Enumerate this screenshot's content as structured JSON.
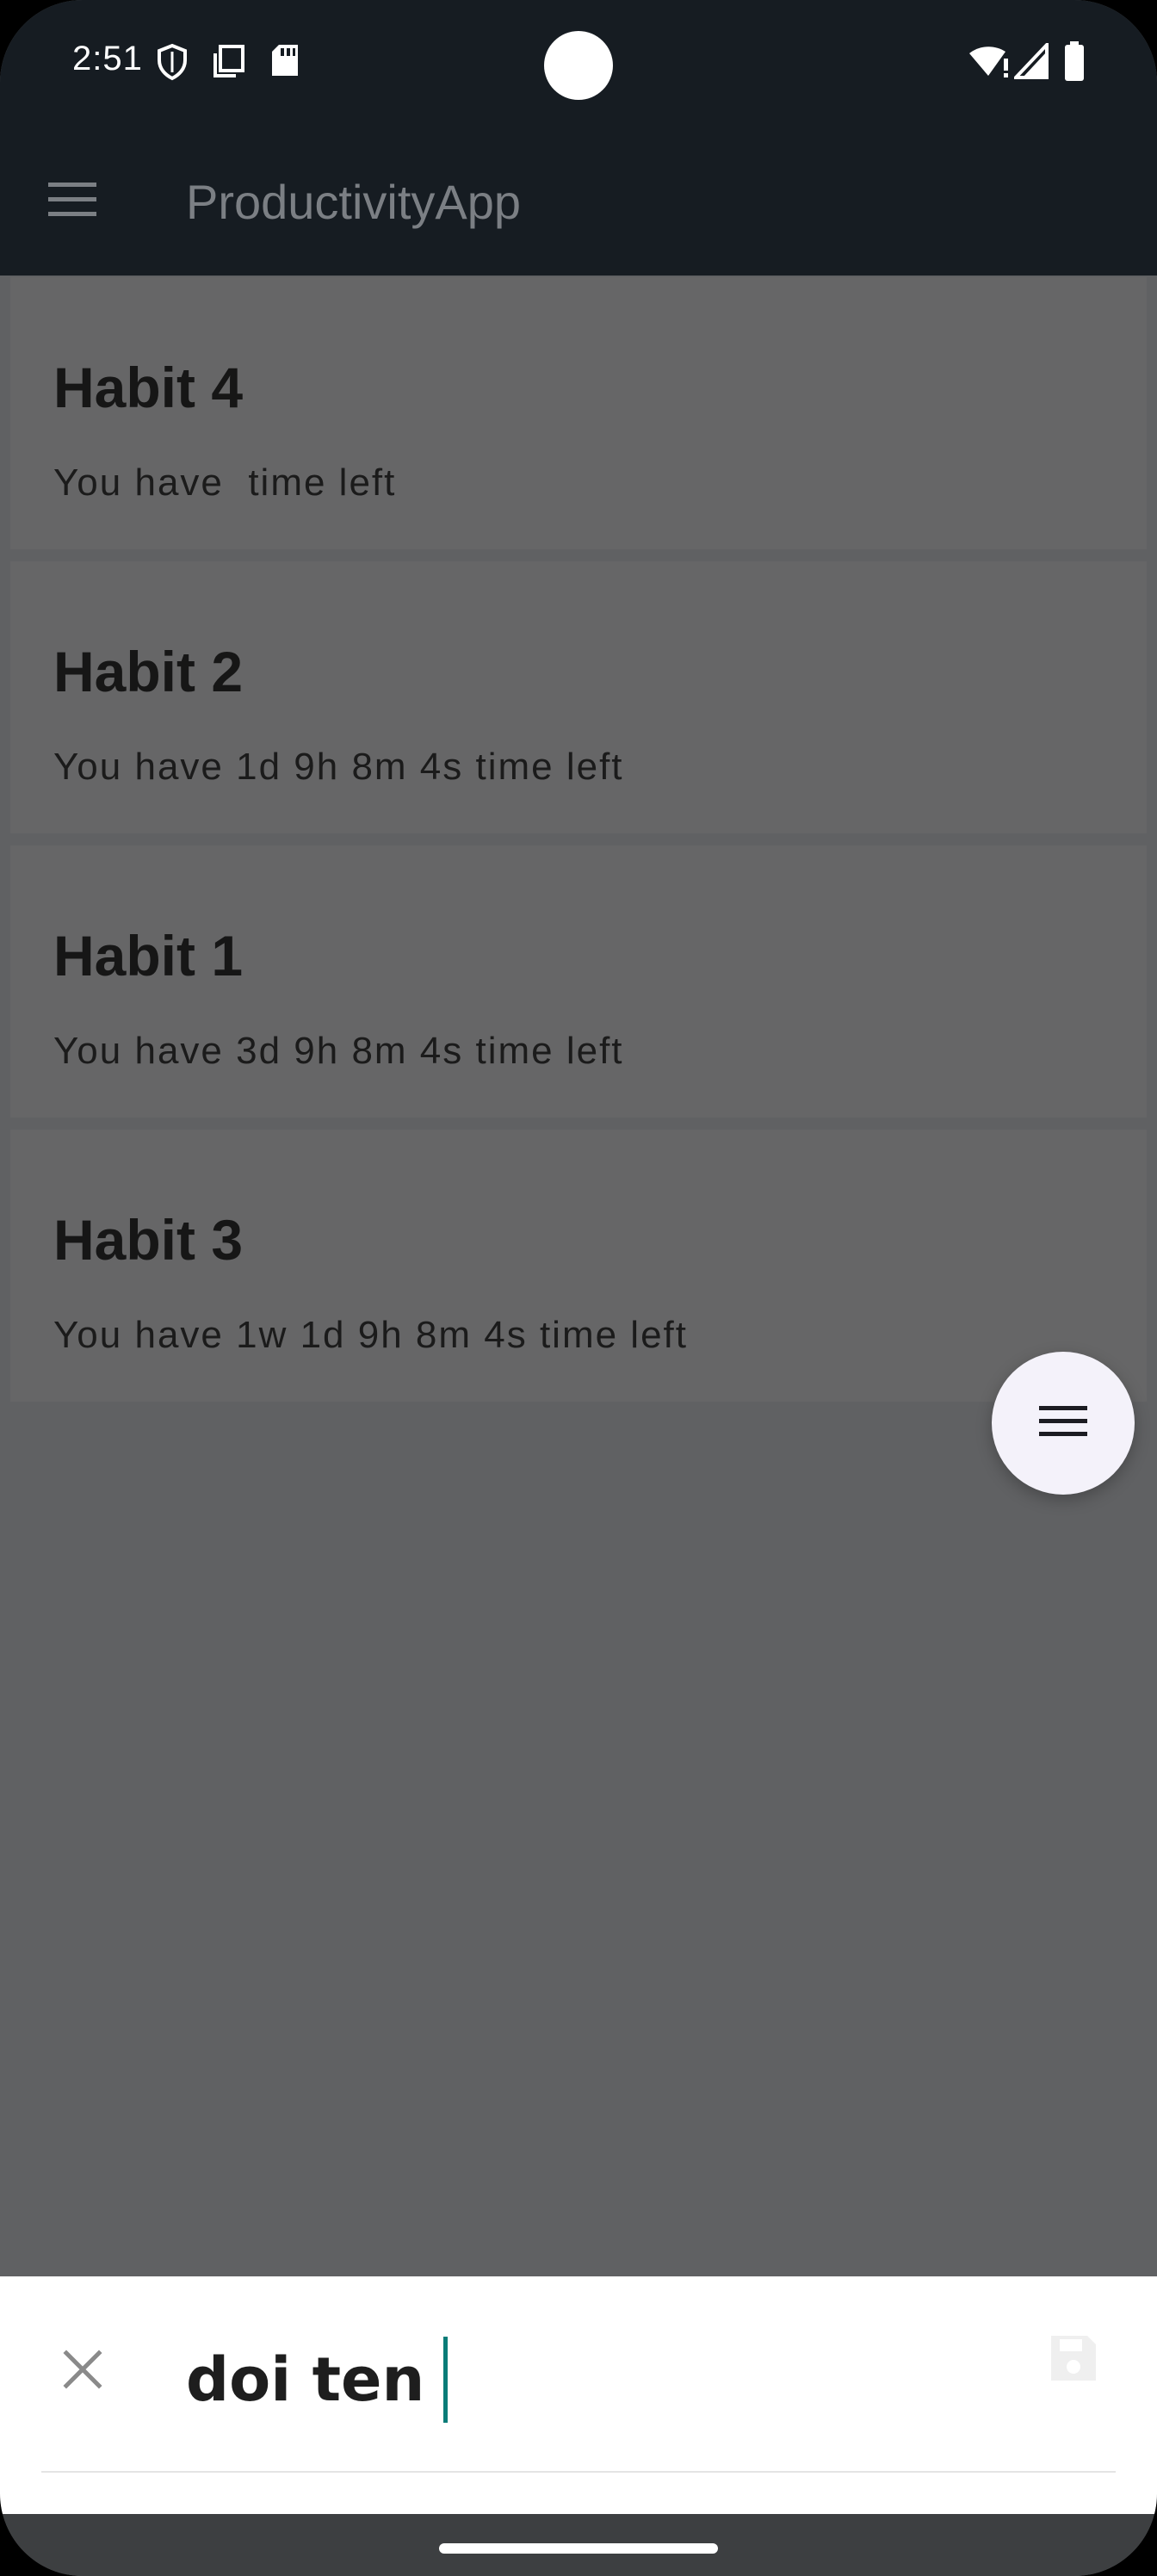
{
  "status_bar": {
    "time": "2:51",
    "left_icons": [
      "shield-icon",
      "copy-icon",
      "sd-card-icon"
    ],
    "right_icons": [
      "wifi-alert-icon",
      "signal-icon",
      "battery-icon"
    ]
  },
  "app_bar": {
    "menu_icon": "hamburger-icon",
    "title": "ProductivityApp"
  },
  "habits": [
    {
      "name": "Habit 4",
      "time_text": "You have  time left"
    },
    {
      "name": "Habit 2",
      "time_text": "You have 1d 9h 8m 4s time left"
    },
    {
      "name": "Habit 1",
      "time_text": "You have 3d 9h 8m 4s time left"
    },
    {
      "name": "Habit 3",
      "time_text": "You have 1w 1d 9h 8m 4s time left"
    }
  ],
  "fab": {
    "icon": "menu-lines-icon"
  },
  "bottom_sheet": {
    "close_icon": "close-icon",
    "input_value": "doi ten",
    "save_icon": "save-icon"
  },
  "colors": {
    "status_bar_bg": "#161c22",
    "scrim": "#606163",
    "card_bg": "#666667",
    "caret": "#0a7c78",
    "fab_bg": "#f4f2fa"
  }
}
